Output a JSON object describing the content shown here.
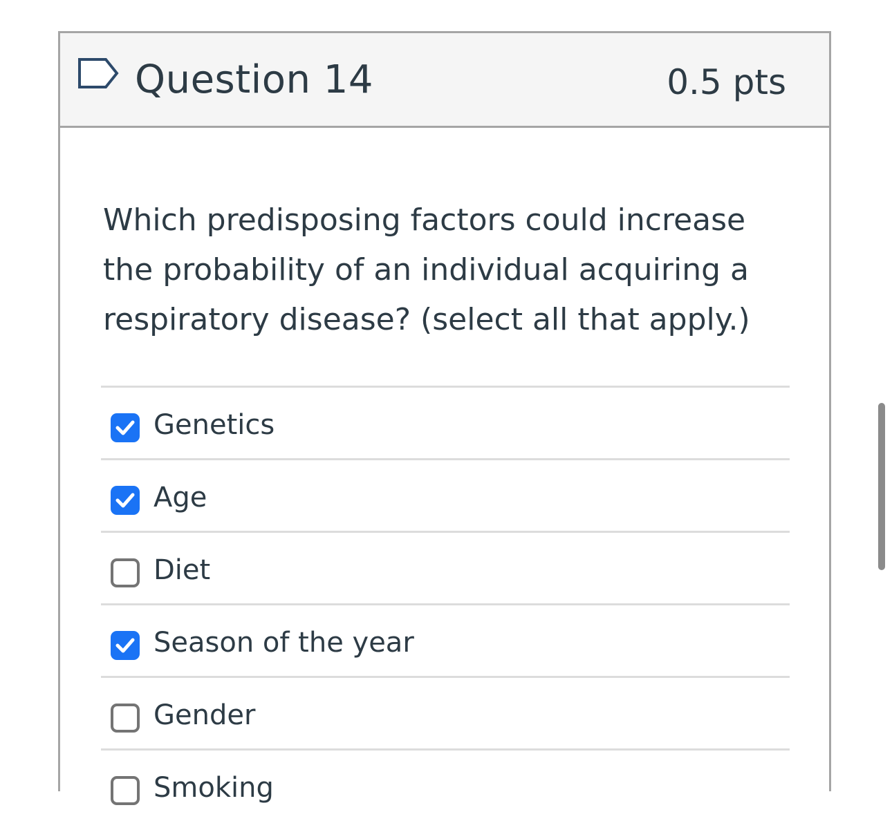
{
  "question": {
    "title": "Question 14",
    "points": "0.5 pts",
    "text": "Which predisposing factors could increase the probability of an individual acquiring a respiratory disease? (select all that apply.)",
    "flag_icon": "flag-icon"
  },
  "answers": [
    {
      "label": "Genetics",
      "checked": true
    },
    {
      "label": "Age",
      "checked": true
    },
    {
      "label": "Diet",
      "checked": false
    },
    {
      "label": "Season of the year",
      "checked": true
    },
    {
      "label": "Gender",
      "checked": false
    },
    {
      "label": "Smoking",
      "checked": false
    }
  ],
  "colors": {
    "checked": "#1a73f5",
    "header_bg": "#f5f5f5",
    "border": "#a5a5a5",
    "text": "#2d3b45"
  }
}
